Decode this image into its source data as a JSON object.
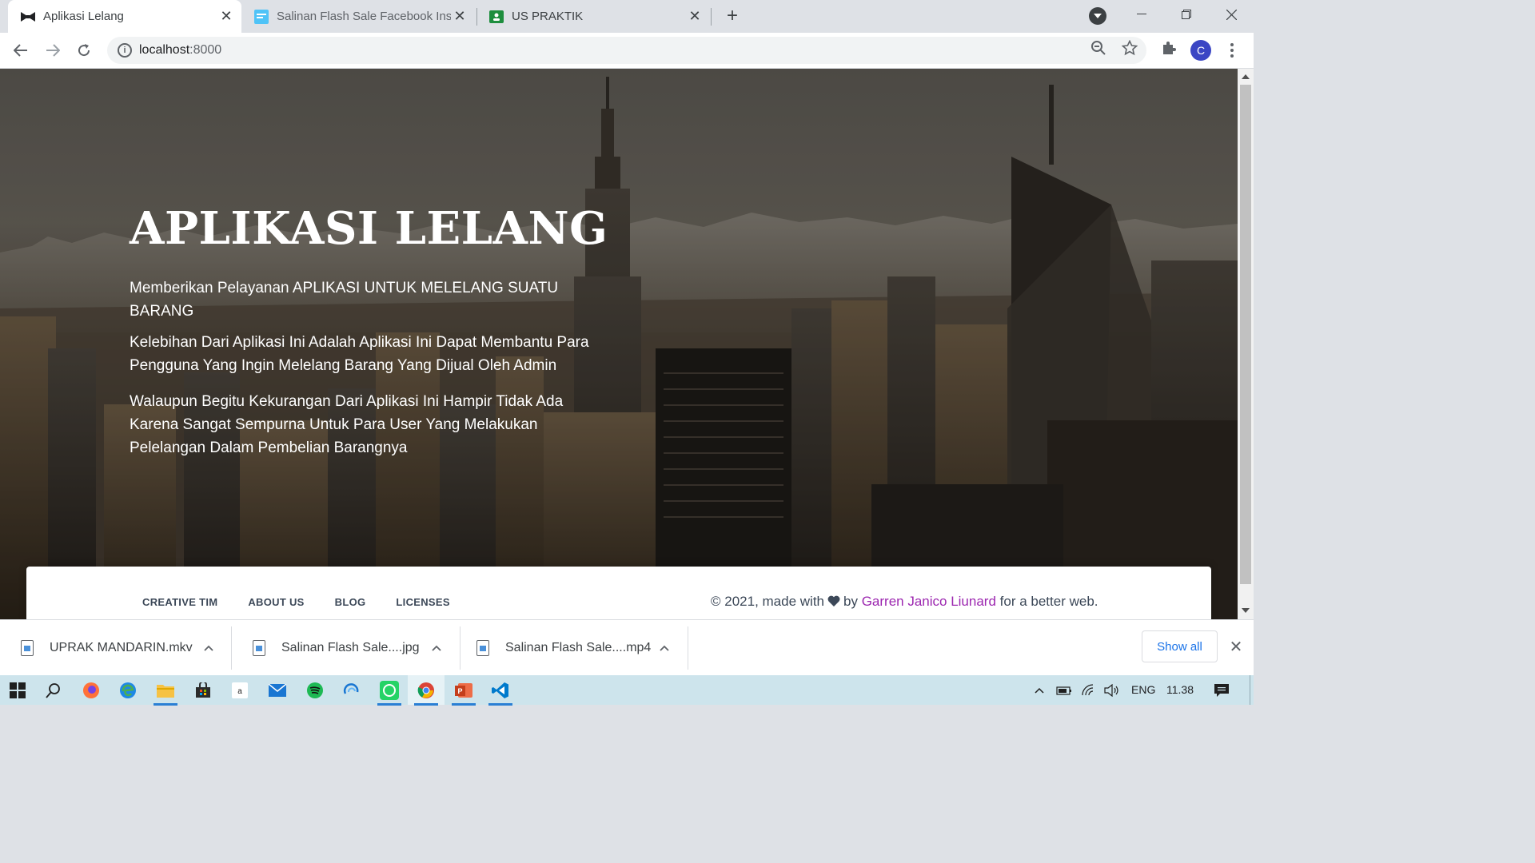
{
  "browser": {
    "tabs": [
      {
        "title": "Aplikasi Lelang",
        "icon": "bowtie-icon",
        "active": true
      },
      {
        "title": "Salinan Flash Sale Facebook Insta",
        "icon": "image-file-icon",
        "active": false
      },
      {
        "title": "US PRAKTIK",
        "icon": "google-classroom-icon",
        "active": false
      }
    ],
    "url_host": "localhost",
    "url_port": ":8000",
    "profile_initial": "C"
  },
  "hero": {
    "title": "APLIKASI LELANG",
    "paragraphs": [
      "Memberikan Pelayanan APLIKASI UNTUK MELELANG SUATU BARANG",
      "Kelebihan Dari Aplikasi Ini Adalah Aplikasi Ini Dapat Membantu Para Pengguna Yang Ingin Melelang Barang Yang Dijual Oleh Admin",
      "Walaupun Begitu Kekurangan Dari Aplikasi Ini Hampir Tidak Ada Karena Sangat Sempurna Untuk Para User Yang Melakukan Pelelangan Dalam Pembelian Barangnya"
    ]
  },
  "footer": {
    "links": [
      "CREATIVE TIM",
      "ABOUT US",
      "BLOG",
      "LICENSES"
    ],
    "copyright_prefix": "© 2021, made with",
    "by": "by",
    "author": "Garren Janico Liunard",
    "suffix": "for a better web."
  },
  "downloads": {
    "items": [
      "UPRAK MANDARIN.mkv",
      "Salinan Flash Sale....jpg",
      "Salinan Flash Sale....mp4"
    ],
    "show_all": "Show all"
  },
  "taskbar": {
    "language": "ENG",
    "time": "11.38"
  },
  "colors": {
    "accent_link": "#9c27b0",
    "download_link": "#1a73e8",
    "profile": "#3b46c4"
  }
}
